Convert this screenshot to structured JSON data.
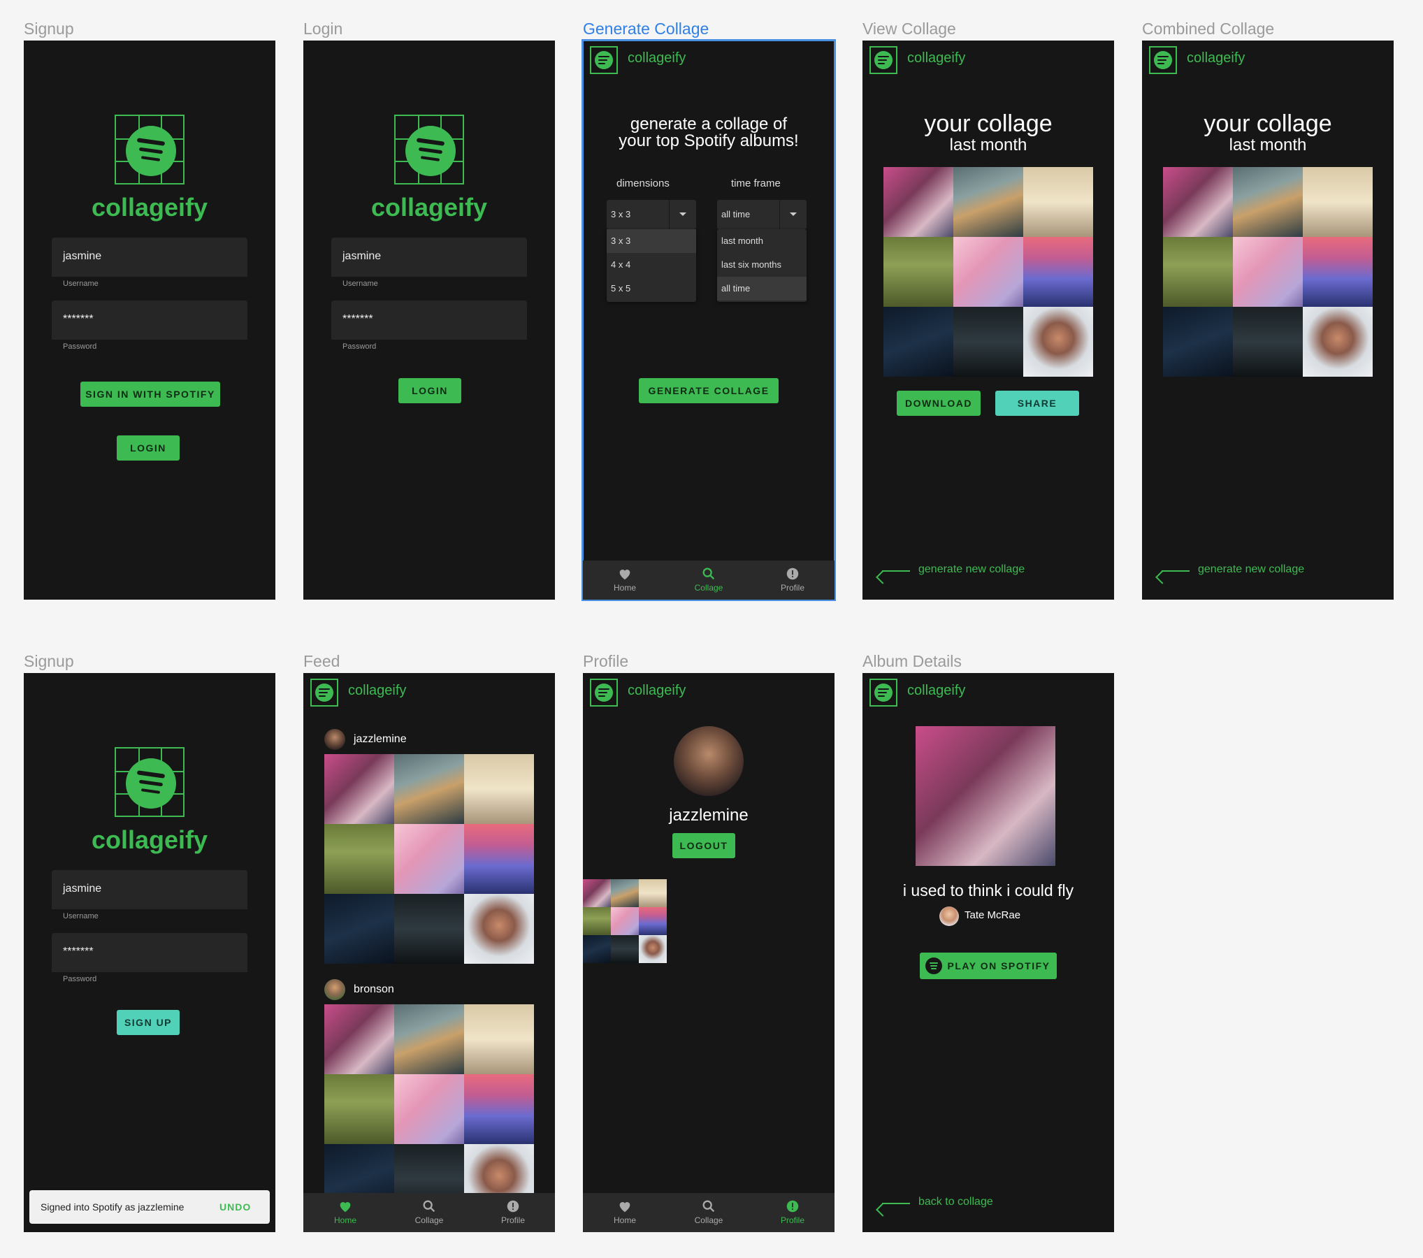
{
  "brand": {
    "name": "collageify",
    "green": "#3dbb52",
    "teal": "#52d1b9",
    "frame_bg": "#161616"
  },
  "frames": {
    "signup": {
      "label": "Signup"
    },
    "login": {
      "label": "Login"
    },
    "generate": {
      "label": "Generate Collage"
    },
    "view": {
      "label": "View Collage"
    },
    "combined": {
      "label": "Combined Collage"
    },
    "signup2": {
      "label": "Signup"
    },
    "feed": {
      "label": "Feed"
    },
    "profile": {
      "label": "Profile"
    },
    "album": {
      "label": "Album Details"
    }
  },
  "auth": {
    "username_value": "jasmine",
    "username_helper": "Username",
    "password_value": "*******",
    "password_helper": "Password",
    "sign_in_spotify": "SIGN IN WITH SPOTIFY",
    "login": "LOGIN",
    "sign_up": "SIGN UP"
  },
  "snackbar": {
    "message": "Signed into Spotify as jazzlemine",
    "action": "UNDO"
  },
  "generate": {
    "heading_line1": "generate a collage of",
    "heading_line2": "your top Spotify albums!",
    "dimensions_label": "dimensions",
    "timeframe_label": "time frame",
    "dimensions_selected": "3 x 3",
    "dimension_options": [
      "3 x 3",
      "4 x 4",
      "5 x 5"
    ],
    "timeframe_selected": "all time",
    "timeframe_options": [
      "last month",
      "last six months",
      "all time"
    ],
    "generate_button": "GENERATE COLLAGE"
  },
  "view": {
    "title": "your collage",
    "subtitle": "last month",
    "download": "DOWNLOAD",
    "share": "SHARE",
    "back_link": "generate new collage"
  },
  "nav": {
    "home": "Home",
    "collage": "Collage",
    "profile": "Profile"
  },
  "feed": {
    "user1": "jazzlemine",
    "user2": "bronson"
  },
  "profile": {
    "username": "jazzlemine",
    "logout": "LOGOUT"
  },
  "album": {
    "title": "i used to think i could fly",
    "artist": "Tate McRae",
    "play_button": "PLAY ON SPOTIFY",
    "back_link": "back to collage"
  },
  "icons": [
    "spotify-logo-icon",
    "heart-icon",
    "search-icon",
    "alert-circle-icon",
    "chevron-down-icon",
    "arrow-left-icon"
  ]
}
